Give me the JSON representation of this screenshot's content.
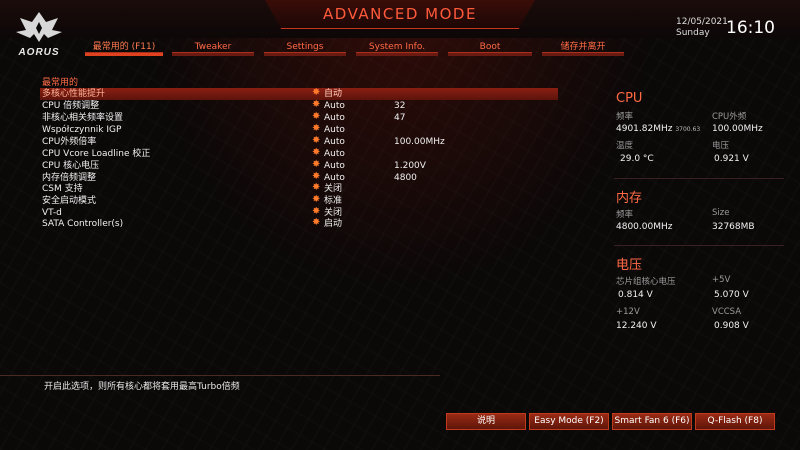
{
  "header": {
    "mode_title": "ADVANCED MODE",
    "logo_text": "AORUS",
    "date": "12/05/2021",
    "weekday": "Sunday",
    "time": "16:10"
  },
  "tabs": [
    {
      "label": "最常用的 (F11)",
      "active": true
    },
    {
      "label": "Tweaker",
      "active": false
    },
    {
      "label": "Settings",
      "active": false
    },
    {
      "label": "System Info.",
      "active": false
    },
    {
      "label": "Boot",
      "active": false
    },
    {
      "label": "储存并离开",
      "active": false
    }
  ],
  "main": {
    "section_title": "最常用的",
    "rows": [
      {
        "label": "多核心性能提升",
        "value": "自动",
        "current": "",
        "selected": true
      },
      {
        "label": "CPU 倍频调整",
        "value": "Auto",
        "current": "32",
        "selected": false
      },
      {
        "label": "非核心相关频率设置",
        "value": "Auto",
        "current": "47",
        "selected": false
      },
      {
        "label": "Współczynnik IGP",
        "value": "Auto",
        "current": "",
        "selected": false
      },
      {
        "label": "CPU外频倍率",
        "value": "Auto",
        "current": "100.00MHz",
        "selected": false
      },
      {
        "label": "CPU Vcore Loadline 校正",
        "value": "Auto",
        "current": "",
        "selected": false
      },
      {
        "label": "CPU 核心电压",
        "value": "Auto",
        "current": "1.200V",
        "selected": false
      },
      {
        "label": "内存倍频调整",
        "value": "Auto",
        "current": "4800",
        "selected": false
      },
      {
        "label": "CSM 支持",
        "value": "关闭",
        "current": "",
        "selected": false
      },
      {
        "label": "安全启动模式",
        "value": "标准",
        "current": "",
        "selected": false
      },
      {
        "label": "VT-d",
        "value": "关闭",
        "current": "",
        "selected": false
      },
      {
        "label": "SATA Controller(s)",
        "value": "启动",
        "current": "",
        "selected": false
      }
    ]
  },
  "monitor": {
    "cpu": {
      "title": "CPU",
      "freq_label": "频率",
      "freq_value": "4901.82MHz",
      "freq_sub": "3700.63",
      "bclk_label": "CPU外频",
      "bclk_value": "100.00MHz",
      "temp_label": "温度",
      "temp_value": "29.0 °C",
      "volt_label": "电压",
      "volt_value": "0.921 V"
    },
    "memory": {
      "title": "内存",
      "freq_label": "频率",
      "freq_value": "4800.00MHz",
      "size_label": "Size",
      "size_value": "32768MB"
    },
    "voltage": {
      "title": "电压",
      "chipset_label": "芯片组核心电压",
      "chipset_value": "0.814 V",
      "p5v_label": "+5V",
      "p5v_value": "5.070 V",
      "p12v_label": "+12V",
      "p12v_value": "12.240 V",
      "vccsa_label": "VCCSA",
      "vccsa_value": "0.908 V"
    }
  },
  "help_text": "开启此选项，则所有核心都将套用最高Turbo倍频",
  "bottom_buttons": {
    "help": "说明",
    "easy_mode": "Easy Mode (F2)",
    "smart_fan": "Smart Fan 6 (F6)",
    "qflash": "Q-Flash (F8)"
  },
  "colors": {
    "accent": "#ff5a3a",
    "selected_row": "#8a1f12",
    "button_bg": "#8a2412"
  }
}
